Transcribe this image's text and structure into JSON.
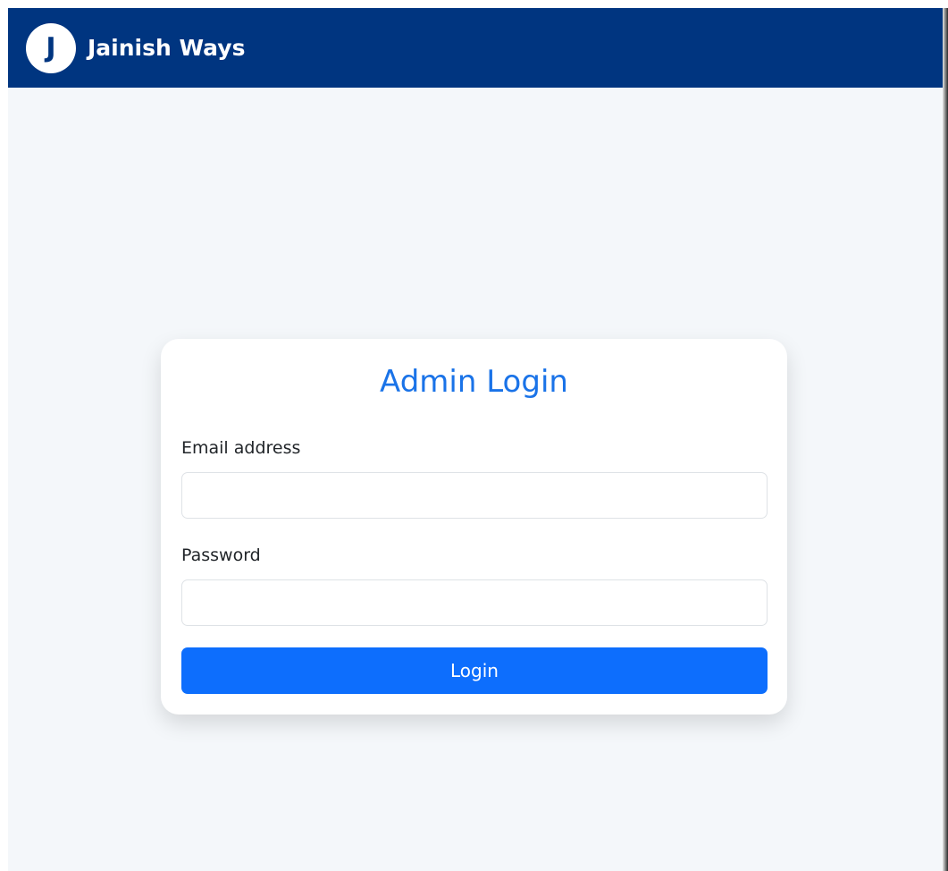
{
  "navbar": {
    "logo_letter": "J",
    "brand_name": "Jainish Ways",
    "background_color": "#003580"
  },
  "login_card": {
    "title": "Admin Login",
    "title_color": "#1a73e8",
    "email": {
      "label": "Email address",
      "value": "",
      "placeholder": ""
    },
    "password": {
      "label": "Password",
      "value": "",
      "placeholder": ""
    },
    "submit_label": "Login",
    "submit_color": "#0d6efd"
  }
}
